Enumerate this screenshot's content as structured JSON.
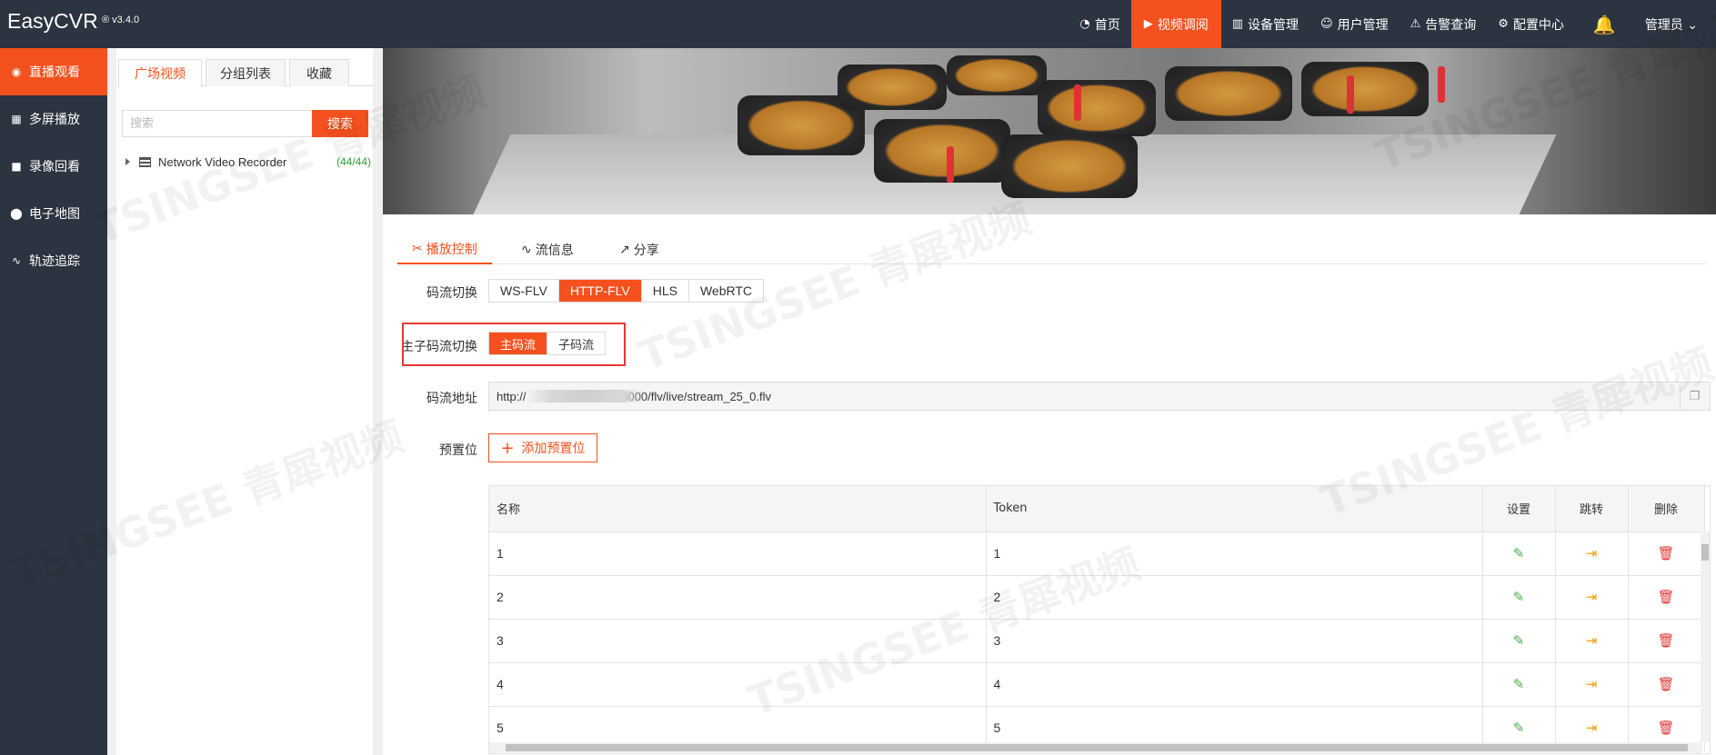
{
  "app": {
    "title": "EasyCVR",
    "version": "® v3.4.0"
  },
  "topnav": [
    {
      "label": "首页",
      "icon": "dashboard-icon"
    },
    {
      "label": "视频调阅",
      "icon": "play-circle-icon",
      "active": true
    },
    {
      "label": "设备管理",
      "icon": "device-icon"
    },
    {
      "label": "用户管理",
      "icon": "user-icon"
    },
    {
      "label": "告警查询",
      "icon": "alarm-icon"
    },
    {
      "label": "配置中心",
      "icon": "gear-icon"
    }
  ],
  "user": {
    "label": "管理员 ⌄"
  },
  "sidebar": [
    {
      "label": "直播观看",
      "icon": "live-icon",
      "active": true
    },
    {
      "label": "多屏播放",
      "icon": "grid-icon"
    },
    {
      "label": "录像回看",
      "icon": "video-icon"
    },
    {
      "label": "电子地图",
      "icon": "map-pin-icon"
    },
    {
      "label": "轨迹追踪",
      "icon": "track-icon"
    }
  ],
  "tree": {
    "tabs": [
      "广场视频",
      "分组列表",
      "收藏"
    ],
    "search_placeholder": "搜索",
    "search_button": "搜索",
    "node": {
      "label": "Network Video Recorder",
      "count": "(44/44)"
    }
  },
  "panel": {
    "tabs": [
      "播放控制",
      "流信息",
      "分享"
    ],
    "stream_label": "码流切换",
    "stream_options": [
      "WS-FLV",
      "HTTP-FLV",
      "HLS",
      "WebRTC"
    ],
    "stream_active": "HTTP-FLV",
    "substream_label": "主子码流切换",
    "substream_options": [
      "主码流",
      "子码流"
    ],
    "url_label": "码流地址",
    "url_prefix": "http://",
    "url_suffix": "18000/flv/live/stream_25_0.flv",
    "preset_label": "预置位",
    "add_preset": "添加预置位"
  },
  "table": {
    "headers": [
      "名称",
      "Token",
      "设置",
      "跳转",
      "删除"
    ],
    "rows": [
      {
        "name": "1",
        "token": "1"
      },
      {
        "name": "2",
        "token": "2"
      },
      {
        "name": "3",
        "token": "3"
      },
      {
        "name": "4",
        "token": "4"
      },
      {
        "name": "5",
        "token": "5"
      }
    ]
  },
  "watermark": "TSINGSEE 青犀视频",
  "colors": {
    "accent": "#f4511e",
    "dark": "#2b3440",
    "green": "#4caf50",
    "orange": "#f59e0b",
    "red": "#e53935"
  }
}
